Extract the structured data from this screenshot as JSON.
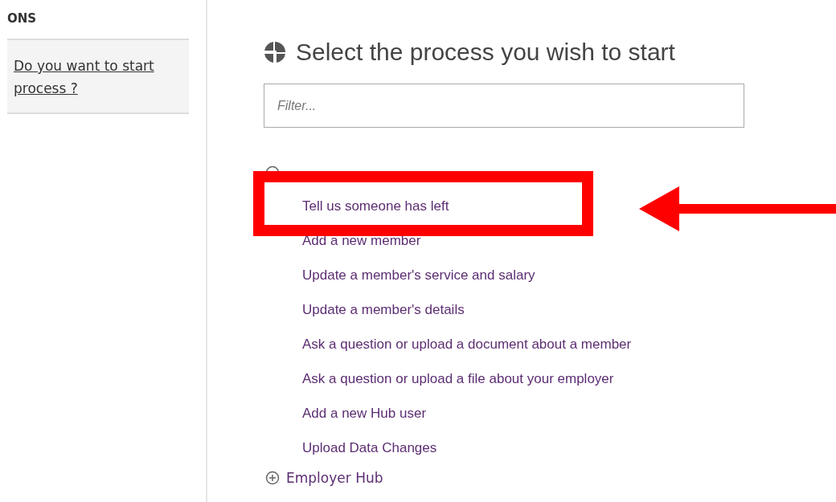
{
  "sidebar": {
    "heading": "ONS",
    "link": "Do you want to start process ?"
  },
  "main": {
    "title": "Select the process you wish to start",
    "filter": {
      "placeholder": "Filter..."
    },
    "groups": [
      {
        "expanded": true,
        "items": [
          {
            "label": "Tell us someone has left",
            "highlighted": true
          },
          {
            "label": "Add a new member",
            "highlighted": false
          },
          {
            "label": "Update a member's service and salary",
            "highlighted": false
          },
          {
            "label": "Update a member's details",
            "highlighted": false
          },
          {
            "label": "Ask a question or upload a document about a member",
            "highlighted": false
          },
          {
            "label": "Ask a question or upload a file about your employer",
            "highlighted": false
          },
          {
            "label": "Add a new Hub user",
            "highlighted": false
          },
          {
            "label": "Upload Data Changes",
            "highlighted": false
          }
        ]
      },
      {
        "label": "Employer Hub",
        "expanded": false
      }
    ]
  }
}
